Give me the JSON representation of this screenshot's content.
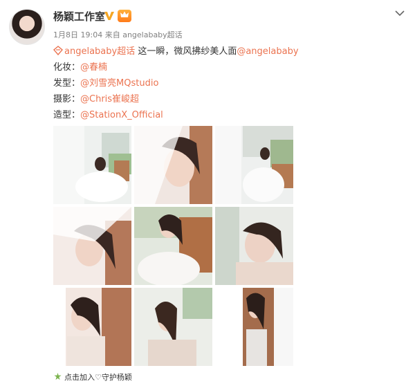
{
  "post": {
    "author_name": "杨颖工作室",
    "svip_label": "",
    "meta": {
      "date": "1月8日 19:04",
      "from_text": "来自",
      "source": "angelababy超话"
    },
    "lines": [
      {
        "topic": "angelababy超话",
        "text": " 这一瞬，微风拂纱美人面",
        "mention": "@angelababy"
      },
      {
        "label": "化妆：",
        "mention": "@春楠"
      },
      {
        "label": "发型：",
        "mention": "@刘雪亮MQstudio"
      },
      {
        "label": "摄影：",
        "mention": "@Chris崔峻超"
      },
      {
        "label": "造型：",
        "mention": "@StationX_Official"
      }
    ],
    "footer_text": "点击加入♡守护杨颖"
  },
  "icons": {
    "verified": "verified-v-icon",
    "vip": "svip-badge-icon",
    "more": "chevron-down-icon",
    "topic": "super-topic-icon",
    "fan": "fan-club-icon"
  },
  "colors": {
    "link": "#eb7350",
    "meta": "#808080",
    "verified": "#f5a623"
  }
}
